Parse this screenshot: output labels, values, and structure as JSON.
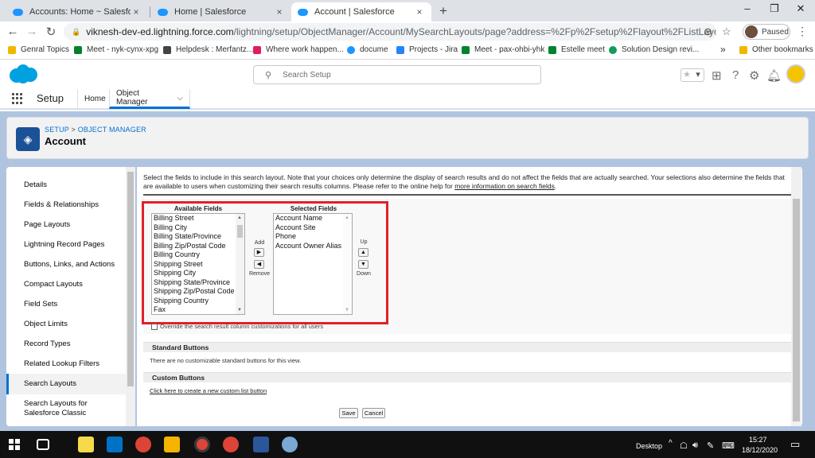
{
  "browser": {
    "tabs": [
      {
        "label": "Accounts: Home ~ Salesforce - De",
        "active": false
      },
      {
        "label": "Home | Salesforce",
        "active": false
      },
      {
        "label": "Account | Salesforce",
        "active": true
      }
    ],
    "new_tab": "+",
    "url_host": "viknesh-dev-ed.lightning.force.com",
    "url_path": "/lightning/setup/ObjectManager/Account/MySearchLayouts/page?address=%2Fp%2Fsetup%2Flayout%2FListLayoutEdit%3FLayoutEn...",
    "profile_status": "Paused",
    "bookmarks": [
      {
        "label": "Genral Topics",
        "color": "#f2b600"
      },
      {
        "label": "Meet - nyk-cynx-xpg",
        "color": "#00832d"
      },
      {
        "label": "Helpdesk : Merfantz...",
        "color": "#444444"
      },
      {
        "label": "Where work happen...",
        "color": "#e01e5a"
      },
      {
        "label": "docume",
        "color": "#1b96ff"
      },
      {
        "label": "Projects - Jira",
        "color": "#2684ff"
      },
      {
        "label": "Meet - pax-ohbi-yhk",
        "color": "#00832d"
      },
      {
        "label": "Estelle meet",
        "color": "#00832d"
      },
      {
        "label": "Solution Design revi...",
        "color": "#0f9d58"
      }
    ],
    "bookmarks_more": "»",
    "other_bookmarks": "Other bookmarks"
  },
  "sf": {
    "search_placeholder": "Search Setup",
    "app_name": "Setup",
    "nav_tabs": [
      {
        "label": "Home"
      },
      {
        "label": "Object Manager"
      }
    ]
  },
  "header": {
    "breadcrumb_setup": "SETUP",
    "breadcrumb_sep": " > ",
    "breadcrumb_om": "OBJECT MANAGER",
    "title": "Account"
  },
  "sidebar": {
    "items": [
      {
        "label": "Details"
      },
      {
        "label": "Fields & Relationships"
      },
      {
        "label": "Page Layouts"
      },
      {
        "label": "Lightning Record Pages"
      },
      {
        "label": "Buttons, Links, and Actions"
      },
      {
        "label": "Compact Layouts"
      },
      {
        "label": "Field Sets"
      },
      {
        "label": "Object Limits"
      },
      {
        "label": "Record Types"
      },
      {
        "label": "Related Lookup Filters"
      },
      {
        "label": "Search Layouts"
      },
      {
        "label": "Search Layouts for"
      },
      {
        "label": "Salesforce Classic"
      }
    ]
  },
  "content": {
    "intro": "Select the fields to include in this search layout. Note that your choices only determine the display of search results and do not affect the fields that are actually searched. Your selections also determine the fields that are available to users when customizing their search results columns. Please refer to the online help for ",
    "intro_link": "more information on search fields",
    "intro_end": ".",
    "available_label": "Available Fields",
    "available_fields": [
      "Billing Street",
      "Billing City",
      "Billing State/Province",
      "Billing Zip/Postal Code",
      "Billing Country",
      "Shipping Street",
      "Shipping City",
      "Shipping State/Province",
      "Shipping Zip/Postal Code",
      "Shipping Country",
      "Fax"
    ],
    "selected_label": "Selected Fields",
    "selected_fields": [
      "Account Name",
      "Account Site",
      "Phone",
      "Account Owner Alias"
    ],
    "add_label": "Add",
    "remove_label": "Remove",
    "up_label": "Up",
    "down_label": "Down",
    "override_label": "Override the search result column customizations for all users",
    "standard_buttons_title": "Standard Buttons",
    "standard_buttons_text": "There are no customizable standard buttons for this view.",
    "custom_buttons_title": "Custom Buttons",
    "custom_buttons_link": "Click here to create a new custom list button",
    "save_label": "Save",
    "cancel_label": "Cancel"
  },
  "taskbar": {
    "desktop_label": "Desktop",
    "time": "15:27",
    "date": "18/12/2020"
  },
  "colors": {
    "brand": "#0070d2",
    "highlight": "#e0202a",
    "background": "#b0c4df"
  }
}
